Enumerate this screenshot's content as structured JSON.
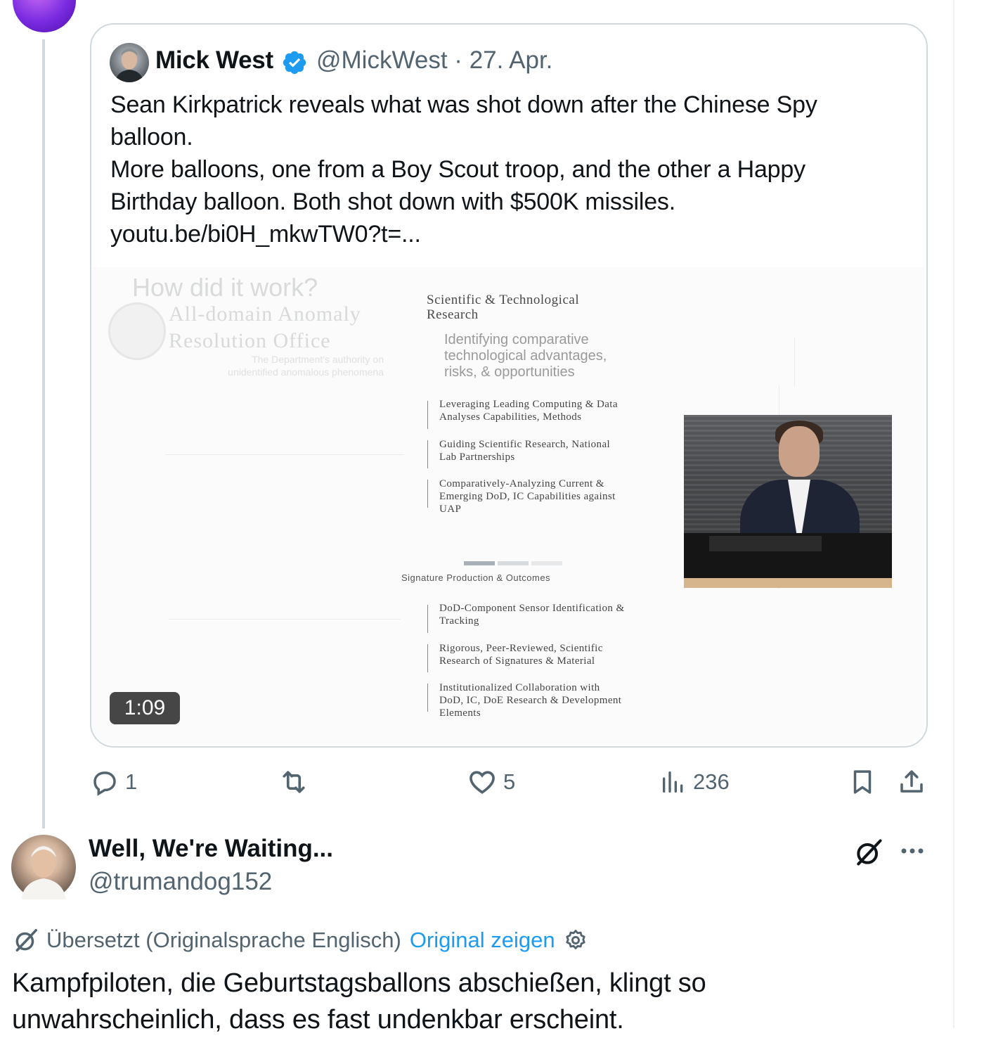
{
  "quoted_tweet": {
    "author_name": "Mick West",
    "handle": "@MickWest",
    "date": "27. Apr.",
    "text": "Sean Kirkpatrick reveals what was shot down after the Chinese Spy\nballoon.\nMore balloons, one from a Boy Scout troop, and the other a Happy\nBirthday balloon.  Both shot down with $500K missiles.\nyoutu.be/bi0H_mkwTW0?t=...",
    "video": {
      "duration": "1:09",
      "slide": {
        "question": "How did it work?",
        "office_line1": "All-domain Anomaly",
        "office_line2": "Resolution Office",
        "dept_text": "The Department's authority on\nunidentified anomalous phenomena",
        "section_title_line1": "Scientific & Technological",
        "section_title_line2": "Research",
        "section_subtitle": "Identifying comparative\n    technological advantages,\n    risks, & opportunities",
        "bullets_top": [
          "Leveraging Leading Computing & Data\nAnalyses Capabilities, Methods",
          "Guiding Scientific Research, National\nLab Partnerships",
          "Comparatively-Analyzing Current &\nEmerging DoD, IC Capabilities against\nUAP"
        ],
        "signature_label": "Signature Production & Outcomes",
        "bullets_bottom": [
          "DoD-Component Sensor Identification &\nTracking",
          "Rigorous, Peer-Reviewed, Scientific\nResearch of Signatures & Material",
          "Institutionalized Collaboration with\nDoD, IC, DoE Research & Development\nElements"
        ]
      }
    }
  },
  "actions": {
    "replies": "1",
    "reposts": "",
    "likes": "5",
    "views": "236"
  },
  "reply_tweet": {
    "author_name": "Well, We're Waiting...",
    "handle": "@trumandog152",
    "translated_label": "Übersetzt (Originalsprache Englisch)",
    "show_original": "Original zeigen",
    "text": "Kampfpiloten, die Geburtstagsballons abschießen, klingt so\nunwahrscheinlich, dass es fast undenkbar erscheint."
  },
  "icons": {
    "verified": "verified-badge-icon",
    "reply": "reply-icon",
    "repost": "repost-icon",
    "like": "heart-icon",
    "views": "views-chart-icon",
    "bookmark": "bookmark-icon",
    "share": "share-icon",
    "grok": "grok-icon",
    "more": "more-icon",
    "settings": "gear-icon"
  },
  "colors": {
    "accent": "#1d9bf0",
    "secondary_text": "#536471",
    "border": "#cfd9de"
  }
}
